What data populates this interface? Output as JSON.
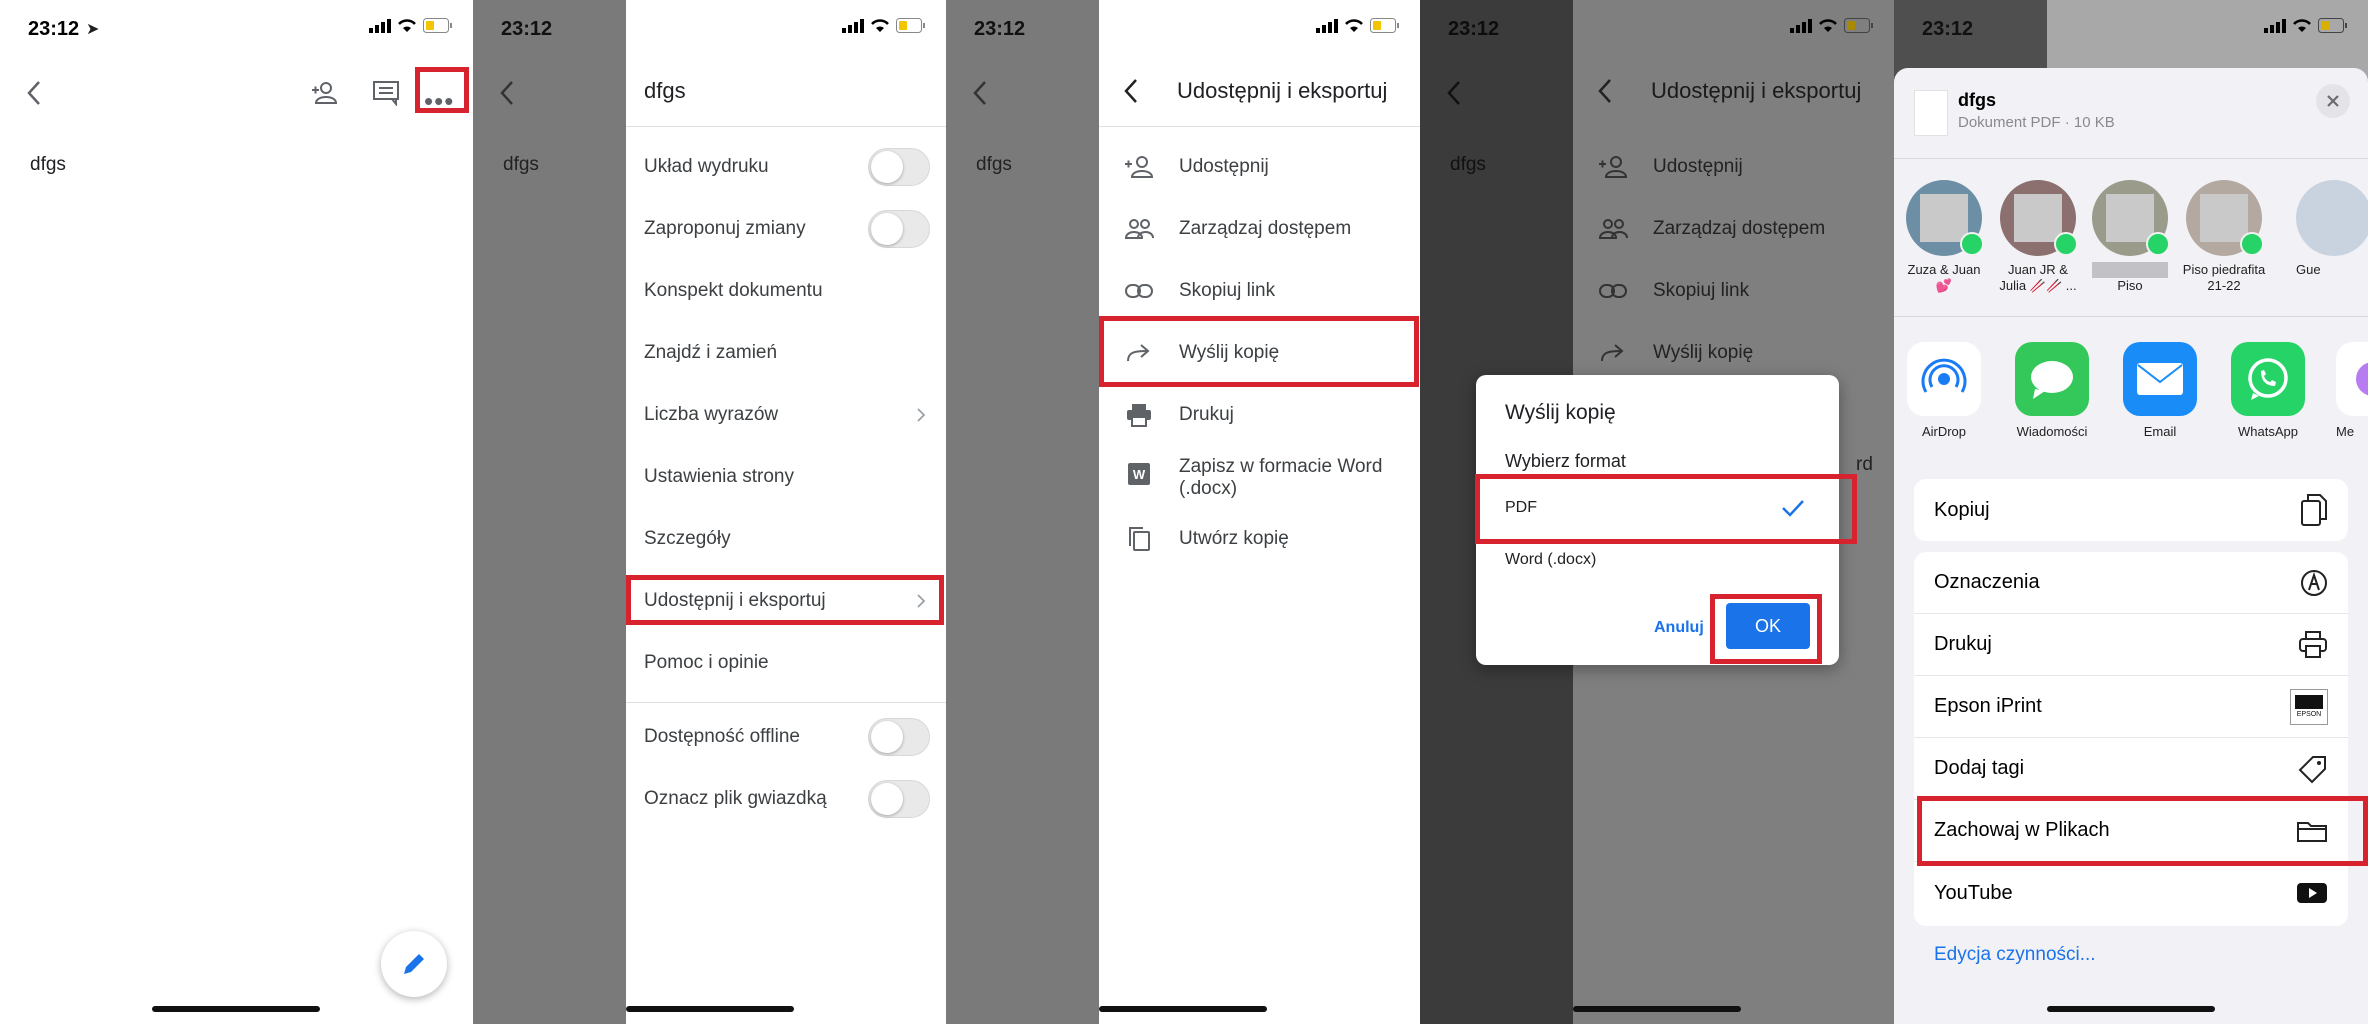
{
  "status": {
    "time": "23:12"
  },
  "doc": {
    "title": "dfgs"
  },
  "menu": {
    "items": [
      {
        "label": "Układ wydruku",
        "toggle": true
      },
      {
        "label": "Zaproponuj zmiany",
        "toggle": true
      },
      {
        "label": "Konspekt dokumentu"
      },
      {
        "label": "Znajdź i zamień"
      },
      {
        "label": "Liczba wyrazów",
        "chevron": true
      },
      {
        "label": "Ustawienia strony"
      },
      {
        "label": "Szczegóły"
      },
      {
        "label": "Udostępnij i eksportuj",
        "chevron": true
      },
      {
        "label": "Pomoc i opinie"
      },
      {
        "label": "Dostępność offline",
        "toggle": true
      },
      {
        "label": "Oznacz plik gwiazdką",
        "toggle": true
      }
    ]
  },
  "share": {
    "title": "Udostępnij i eksportuj",
    "items": [
      {
        "label": "Udostępnij",
        "icon": "add-person-icon"
      },
      {
        "label": "Zarządzaj dostępem",
        "icon": "people-icon"
      },
      {
        "label": "Skopiuj link",
        "icon": "link-icon"
      },
      {
        "label": "Wyślij kopię",
        "icon": "forward-arrow-icon"
      },
      {
        "label": "Drukuj",
        "icon": "printer-icon"
      },
      {
        "label": "Zapisz w formacie Word",
        "label2": "(.docx)",
        "icon": "word-icon"
      },
      {
        "label": "Utwórz kopię",
        "icon": "copy-icon"
      }
    ],
    "partial_label": "rd"
  },
  "dialog": {
    "title": "Wyślij kopię",
    "subtitle": "Wybierz format",
    "option_pdf": "PDF",
    "option_word": "Word (.docx)",
    "cancel": "Anuluj",
    "ok": "OK"
  },
  "sheet": {
    "file_name": "dfgs",
    "file_info": "Dokument PDF · 10 KB",
    "contacts": [
      {
        "name": "Zuza & Juan",
        "name2": "💕"
      },
      {
        "name": "Juan JR &",
        "name2": "Julia 🥢🥢 ..."
      },
      {
        "name": "",
        "name2": "Piso"
      },
      {
        "name": "Piso piedrafita",
        "name2": "21-22"
      },
      {
        "name": "Gue",
        "name2": ""
      }
    ],
    "apps": [
      {
        "name": "AirDrop",
        "icon": "airdrop-icon"
      },
      {
        "name": "Wiadomości",
        "icon": "messages-icon"
      },
      {
        "name": "Email",
        "icon": "mail-icon"
      },
      {
        "name": "WhatsApp",
        "icon": "whatsapp-icon"
      },
      {
        "name": "Me",
        "icon": "more-icon"
      }
    ],
    "action_copy": "Kopiuj",
    "actions": [
      "Oznaczenia",
      "Drukuj",
      "Epson iPrint",
      "Dodaj tagi",
      "Zachowaj w Plikach",
      "YouTube"
    ],
    "epson_label": "EPSON",
    "edit_actions": "Edycja czynności..."
  },
  "colors": {
    "accent": "#1a73e8",
    "highlight": "#d7232d",
    "whatsapp": "#25d366"
  }
}
